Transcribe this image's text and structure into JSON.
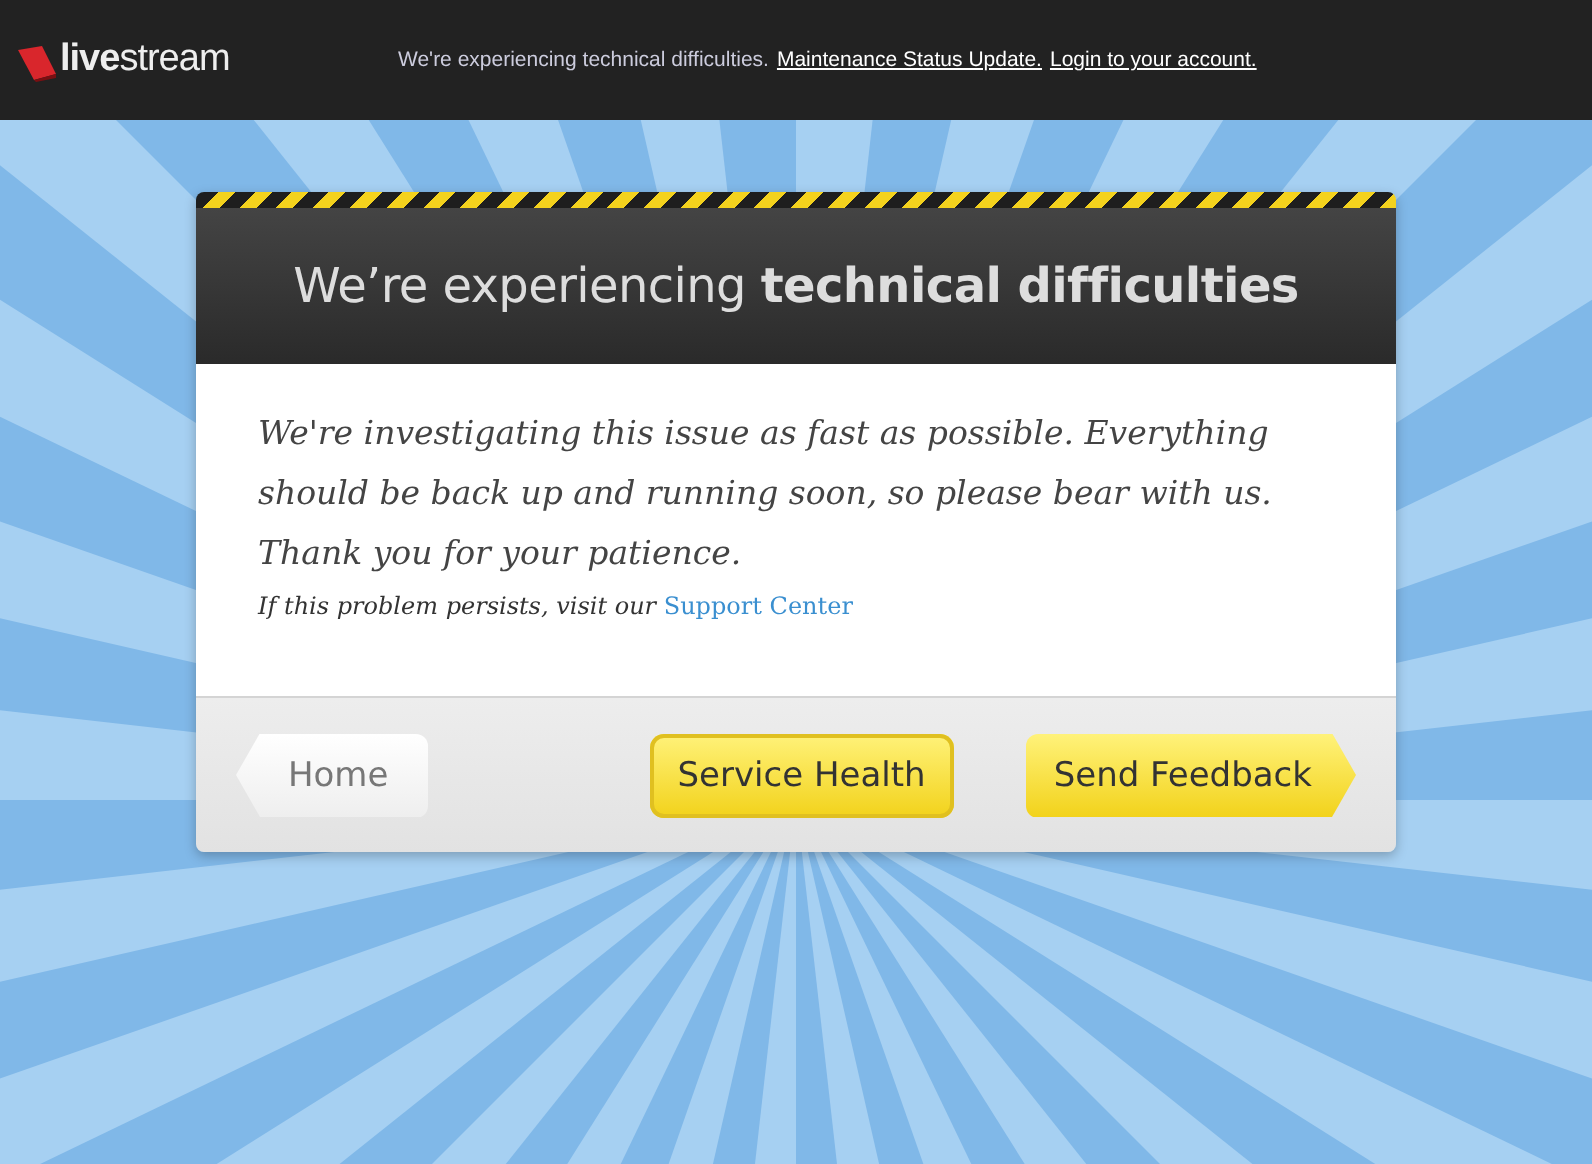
{
  "topbar": {
    "logo": "**live**stream",
    "notice": "We're experiencing technical difficulties.",
    "links": [
      "Maintenance Status Update.",
      "Login to your account."
    ]
  },
  "card": {
    "title": "We’re experiencing **technical difficulties**",
    "message": "We're investigating this issue as fast as possible. Everything should be back up and running soon, so please bear with us. Thank you for your patience.",
    "note": "If this problem persists, visit our",
    "note_link": "Support Center",
    "buttons": [
      {
        "label": "Home",
        "kind": "back"
      },
      {
        "label": "Service Health",
        "kind": "plain"
      },
      {
        "label": "Send Feedback",
        "kind": "forward"
      }
    ]
  }
}
